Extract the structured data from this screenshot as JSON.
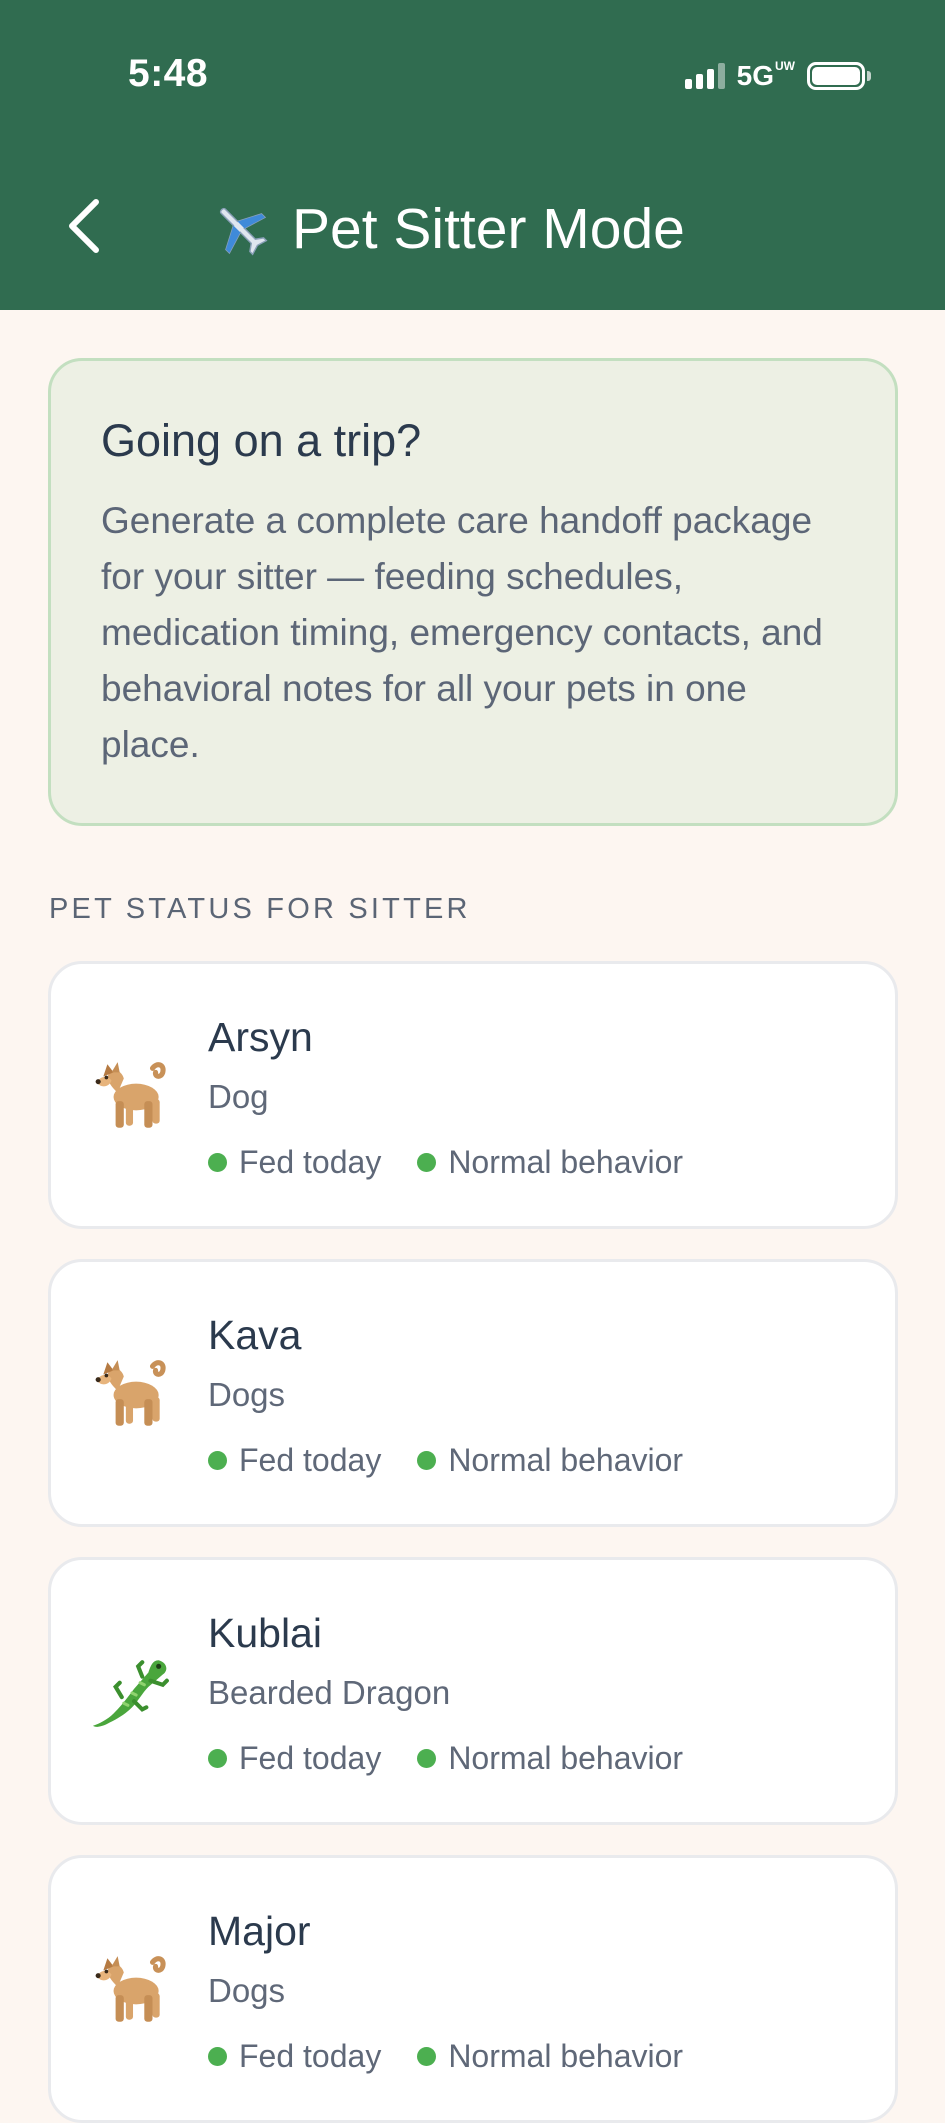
{
  "status_bar": {
    "time": "5:48",
    "network": "5G",
    "network_sub": "UW"
  },
  "header": {
    "title": "Pet Sitter Mode",
    "back_icon": "chevron-left-icon",
    "title_icon": "airplane-icon"
  },
  "intro": {
    "heading": "Going on a trip?",
    "body": "Generate a complete care handoff package for your sitter — feeding schedules, medication timing, emergency contacts, and behavioral notes for all your pets in one place."
  },
  "section_label": "PET STATUS FOR SITTER",
  "pets": [
    {
      "name": "Arsyn",
      "kind": "Dog",
      "icon": "dog-icon",
      "fed": "Fed today",
      "behavior": "Normal behavior"
    },
    {
      "name": "Kava",
      "kind": "Dogs",
      "icon": "dog-icon",
      "fed": "Fed today",
      "behavior": "Normal behavior"
    },
    {
      "name": "Kublai",
      "kind": "Bearded Dragon",
      "icon": "lizard-icon",
      "fed": "Fed today",
      "behavior": "Normal behavior"
    },
    {
      "name": "Major",
      "kind": "Dogs",
      "icon": "dog-icon",
      "fed": "Fed today",
      "behavior": "Normal behavior"
    }
  ],
  "colors": {
    "header": "#306c50",
    "background": "#fdf6f1",
    "status_ok": "#4caf50",
    "intro_bg": "#edf0e4"
  }
}
